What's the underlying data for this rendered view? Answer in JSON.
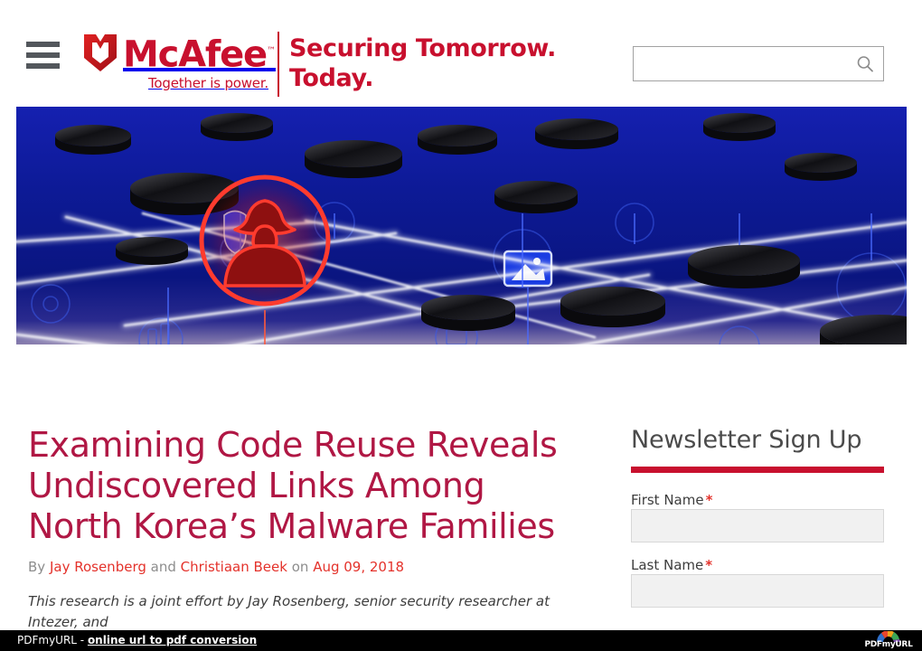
{
  "header": {
    "menu_icon": "hamburger-menu-icon",
    "brand_name": "McAfee",
    "brand_tm": "™",
    "brand_tagline": "Together is power.",
    "campaign_line1": "Securing Tomorrow.",
    "campaign_line2": "Today.",
    "brand_color": "#c8102e",
    "search": {
      "value": "",
      "placeholder": "",
      "icon": "search-icon"
    }
  },
  "hero": {
    "alt": "Blue network of connected nodes with a red hacker-spy icon highlighted in a circle",
    "background_color": "#0a1a8c",
    "highlight_color": "#ff3b2e",
    "node_color": "#111111",
    "link_color": "#ffffff"
  },
  "article": {
    "title": "Examining Code Reuse Reveals Undiscovered Links Among North Korea’s Malware Families",
    "byline_prefix": "By",
    "author_one": "Jay Rosenberg",
    "byline_conjunction": "and",
    "author_two": "Christiaan Beek",
    "byline_on": "on",
    "date": "Aug 09, 2018",
    "lede": "This research is a joint effort by Jay Rosenberg, senior security researcher at Intezer, and",
    "title_color": "#b01744",
    "link_color": "#e4322b"
  },
  "sidebar": {
    "newsletter_title": "Newsletter Sign Up",
    "rule_color": "#c8102e",
    "fields": [
      {
        "label": "First Name",
        "required": "*",
        "value": "",
        "placeholder": "",
        "name": "first-name"
      },
      {
        "label": "Last Name",
        "required": "*",
        "value": "",
        "placeholder": "",
        "name": "last-name"
      }
    ]
  },
  "footer": {
    "brand": "PDFmyURL - ",
    "link": "online url to pdf conversion",
    "logo_text": "PDFmyURL",
    "background_color": "#000000"
  }
}
